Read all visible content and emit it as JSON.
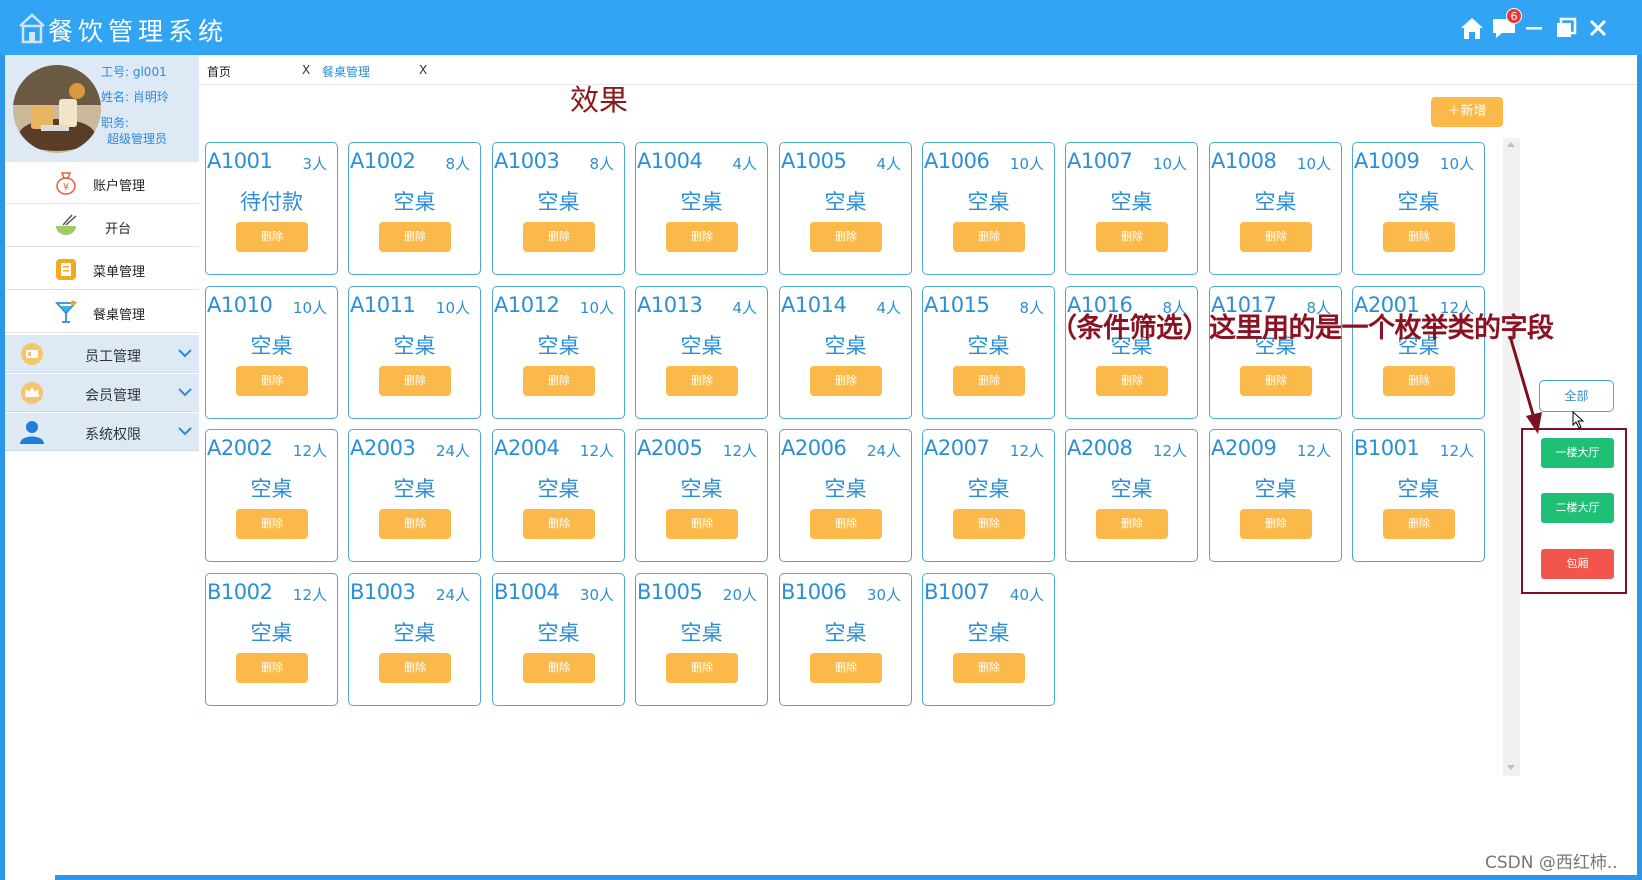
{
  "window": {
    "title": "餐饮管理系统",
    "notification_count": "6"
  },
  "profile": {
    "employee_id": "工号: gl001",
    "name": "姓名: 肖明玲",
    "role_label": "职务:",
    "role": "超级管理员"
  },
  "sidebar": {
    "items": [
      {
        "label": "账户管理",
        "icon": "money-bag-icon"
      },
      {
        "label": "开台",
        "icon": "bowl-icon"
      },
      {
        "label": "菜单管理",
        "icon": "clipboard-icon"
      },
      {
        "label": "餐桌管理",
        "icon": "cocktail-icon"
      }
    ],
    "groups": [
      {
        "label": "员工管理",
        "icon": "id-card-icon"
      },
      {
        "label": "会员管理",
        "icon": "crown-icon"
      },
      {
        "label": "系统权限",
        "icon": "user-icon"
      }
    ]
  },
  "tabs": [
    {
      "label": "首页",
      "close": "X"
    },
    {
      "label": "餐桌管理",
      "close": "X"
    }
  ],
  "page": {
    "effect_label": "效果",
    "add_button": "新增",
    "delete_label": "删除"
  },
  "tables": [
    {
      "code": "A1001",
      "seats": "3人",
      "status": "待付款"
    },
    {
      "code": "A1002",
      "seats": "8人",
      "status": "空桌"
    },
    {
      "code": "A1003",
      "seats": "8人",
      "status": "空桌"
    },
    {
      "code": "A1004",
      "seats": "4人",
      "status": "空桌"
    },
    {
      "code": "A1005",
      "seats": "4人",
      "status": "空桌"
    },
    {
      "code": "A1006",
      "seats": "10人",
      "status": "空桌"
    },
    {
      "code": "A1007",
      "seats": "10人",
      "status": "空桌"
    },
    {
      "code": "A1008",
      "seats": "10人",
      "status": "空桌"
    },
    {
      "code": "A1009",
      "seats": "10人",
      "status": "空桌"
    },
    {
      "code": "A1010",
      "seats": "10人",
      "status": "空桌"
    },
    {
      "code": "A1011",
      "seats": "10人",
      "status": "空桌"
    },
    {
      "code": "A1012",
      "seats": "10人",
      "status": "空桌"
    },
    {
      "code": "A1013",
      "seats": "4人",
      "status": "空桌"
    },
    {
      "code": "A1014",
      "seats": "4人",
      "status": "空桌"
    },
    {
      "code": "A1015",
      "seats": "8人",
      "status": "空桌"
    },
    {
      "code": "A1016",
      "seats": "8人",
      "status": "空桌"
    },
    {
      "code": "A1017",
      "seats": "8人",
      "status": "空桌"
    },
    {
      "code": "A2001",
      "seats": "12人",
      "status": "空桌"
    },
    {
      "code": "A2002",
      "seats": "12人",
      "status": "空桌"
    },
    {
      "code": "A2003",
      "seats": "24人",
      "status": "空桌"
    },
    {
      "code": "A2004",
      "seats": "12人",
      "status": "空桌"
    },
    {
      "code": "A2005",
      "seats": "12人",
      "status": "空桌"
    },
    {
      "code": "A2006",
      "seats": "24人",
      "status": "空桌"
    },
    {
      "code": "A2007",
      "seats": "12人",
      "status": "空桌"
    },
    {
      "code": "A2008",
      "seats": "12人",
      "status": "空桌"
    },
    {
      "code": "A2009",
      "seats": "12人",
      "status": "空桌"
    },
    {
      "code": "B1001",
      "seats": "12人",
      "status": "空桌"
    },
    {
      "code": "B1002",
      "seats": "12人",
      "status": "空桌"
    },
    {
      "code": "B1003",
      "seats": "24人",
      "status": "空桌"
    },
    {
      "code": "B1004",
      "seats": "30人",
      "status": "空桌"
    },
    {
      "code": "B1005",
      "seats": "20人",
      "status": "空桌"
    },
    {
      "code": "B1006",
      "seats": "30人",
      "status": "空桌"
    },
    {
      "code": "B1007",
      "seats": "40人",
      "status": "空桌"
    }
  ],
  "filters": {
    "all": "全部",
    "options": [
      {
        "label": "一楼大厅",
        "color": "#1fbf75"
      },
      {
        "label": "二楼大厅",
        "color": "#1fbf75"
      },
      {
        "label": "包厢",
        "color": "#f2554b"
      }
    ]
  },
  "annotation": "（条件筛选）这里用的是一个枚举类的字段",
  "watermark": "CSDN @西红柿..",
  "colors": {
    "titlebar": "#31a4f3",
    "accent_orange": "#fbb94a",
    "card_text": "#2b8fd6",
    "annotation": "#8a1323"
  }
}
